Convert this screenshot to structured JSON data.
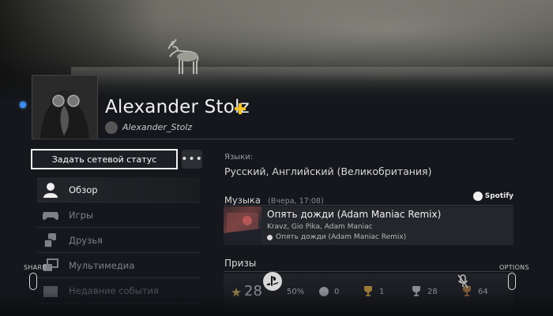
{
  "profile": {
    "name": "Alexander Stolz",
    "psn_id": "Alexander_Stolz",
    "online": true,
    "plus_member": true
  },
  "actions": {
    "set_status_label": "Задать сетевой статус",
    "more_label": "•••"
  },
  "menu": {
    "items": [
      {
        "label": "Обзор",
        "icon": "person-icon",
        "active": true
      },
      {
        "label": "Игры",
        "icon": "gamepad-icon",
        "active": false
      },
      {
        "label": "Друзья",
        "icon": "friends-icon",
        "active": false
      },
      {
        "label": "Мультимедиа",
        "icon": "media-icon",
        "active": false
      },
      {
        "label": "Недавние события",
        "icon": "events-icon",
        "active": false
      }
    ]
  },
  "languages": {
    "label": "Языки:",
    "value": "Русский, Английский (Великобритания)"
  },
  "music": {
    "title": "Музыка",
    "time": "(Вчера, 17:08)",
    "provider": "Spotify",
    "track": {
      "name": "Опять дожди (Adam Maniac Remix)",
      "artists": "Kravz, Gio Pika, Adam Maniac",
      "album": "Опять дожди (Adam Maniac Remix)"
    }
  },
  "trophies": {
    "title": "Призы",
    "level": "28",
    "progress": "50%",
    "platinum": "0",
    "gold": "1",
    "silver": "28",
    "bronze": "64"
  },
  "controller_hints": {
    "share": "SHARE",
    "options": "OPTIONS"
  },
  "colors": {
    "accent": "#3a8ff0",
    "plus": "#f2c12e",
    "background": "#15171c"
  }
}
